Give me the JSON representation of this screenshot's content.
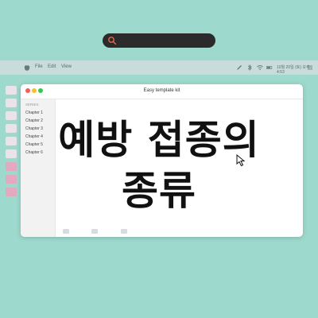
{
  "search": {
    "placeholder": "",
    "icon": "search-icon",
    "accent": "#e8674a"
  },
  "menubar": {
    "items": [
      "File",
      "Edit",
      "View"
    ],
    "clock": "10월 20일 (토) 오후 4:53"
  },
  "desktop": {
    "icon_labels": [
      "",
      "",
      "",
      "",
      "",
      "",
      "",
      "",
      "",
      "",
      "",
      ""
    ]
  },
  "window": {
    "title": "Easy template kit",
    "sidebar_header": "SERIES",
    "chapters": [
      "Chapter 1",
      "Chapter 2",
      "Chapter 3",
      "Chapter 4",
      "Chapter 5",
      "Chapter 6"
    ]
  },
  "headline": {
    "line1": "예방 접종의",
    "line2": "종류"
  },
  "colors": {
    "background": "#9dd9cc",
    "traffic_red": "#f25f58",
    "traffic_yellow": "#fbbc2f",
    "traffic_green": "#3ac64b"
  }
}
